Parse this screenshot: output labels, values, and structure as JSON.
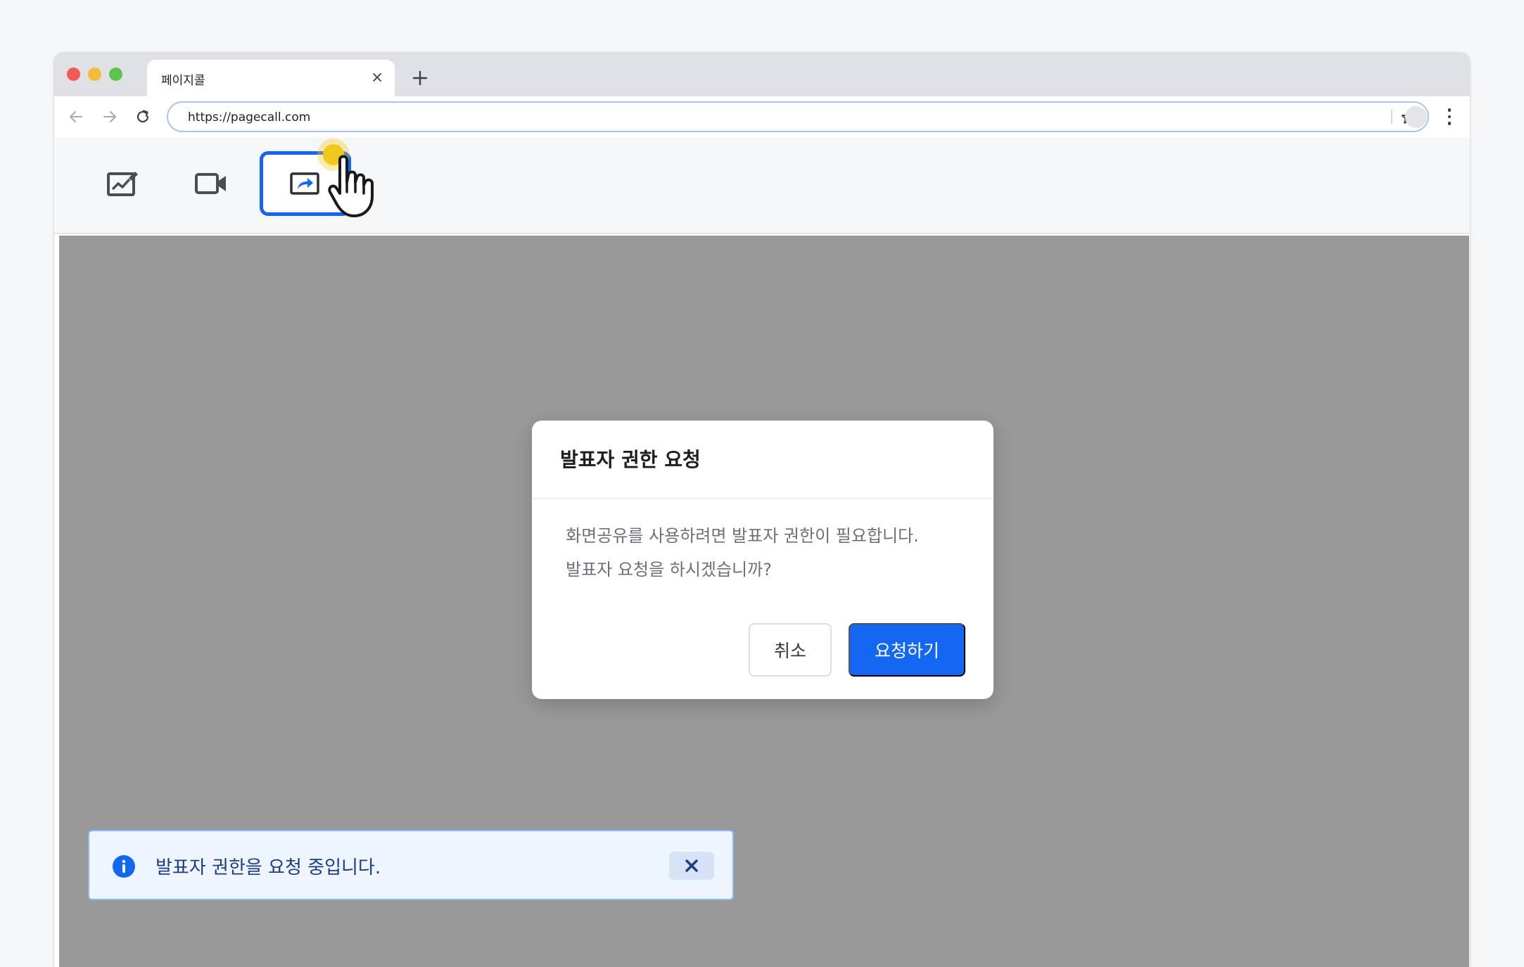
{
  "browser": {
    "tab_title": "페이지콜",
    "url": "https://pagecall.com"
  },
  "toolbar": {
    "tools": [
      {
        "icon": "whiteboard-edit-icon"
      },
      {
        "icon": "video-camera-icon"
      },
      {
        "icon": "screen-share-icon",
        "active": true
      }
    ]
  },
  "modal": {
    "title": "발표자 권한 요청",
    "body_line1": "화면공유를 사용하려면 발표자 권한이 필요합니다.",
    "body_line2": "발표자 요청을 하시겠습니까?",
    "cancel_label": "취소",
    "confirm_label": "요청하기"
  },
  "toast": {
    "message": "발표자 권한을 요청 중입니다.",
    "icon": "info-icon"
  },
  "colors": {
    "accent": "#1467f3",
    "stage_background": "#999999",
    "toast_background": "#eef5ff"
  }
}
